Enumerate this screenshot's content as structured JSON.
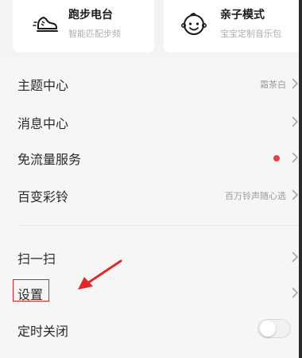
{
  "cards": [
    {
      "title": "跑步电台",
      "subtitle": "智能匹配步频",
      "icon": "running-shoe-icon"
    },
    {
      "title": "亲子模式",
      "subtitle": "宝宝定制音乐包",
      "icon": "baby-face-icon"
    }
  ],
  "menu": [
    {
      "label": "主题中心",
      "value": "霜茶白"
    },
    {
      "label": "消息中心",
      "value": ""
    },
    {
      "label": "免流量服务",
      "value": ""
    },
    {
      "label": "百变彩铃",
      "value": "百万铃声随心选"
    },
    {
      "label": "扫一扫",
      "value": ""
    },
    {
      "label": "设置",
      "value": ""
    },
    {
      "label": "定时关闭",
      "value": ""
    }
  ],
  "colors": {
    "notification_dot": "#e9404b",
    "annotation_red": "#d9252a"
  },
  "timer_toggle": {
    "on": false
  }
}
